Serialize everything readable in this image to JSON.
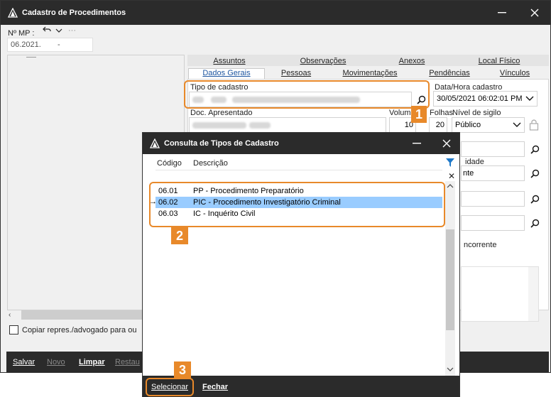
{
  "main": {
    "title": "Cadastro de Procedimentos",
    "nmp_label": "Nº MP :",
    "nmp_value": "06.2021.",
    "nmp_dash": "-",
    "tabs_row1": [
      "Assuntos",
      "Observações",
      "Anexos",
      "Local Físico"
    ],
    "tabs_row2": [
      "Dados Gerais",
      "Pessoas",
      "Movimentações",
      "Pendências",
      "Vínculos"
    ],
    "tipo_label": "Tipo de cadastro",
    "datahora_label": "Data/Hora cadastro",
    "datahora_value": "30/05/2021 06:02:01 PM",
    "doc_label": "Doc. Apresentado",
    "volume_label": "Volume",
    "volume_value": "10",
    "folhas_label": "Folhas",
    "folhas_value": "20",
    "sigilo_label": "Nível de sigilo",
    "sigilo_value": "Público",
    "unidade_label": "idade",
    "unidade_value": "nte",
    "concorrente_label": "ncorrente",
    "copiar_label": "Copiar repres./advogado para ou",
    "bottom": {
      "salvar": "Salvar",
      "novo": "Novo",
      "limpar": "Limpar",
      "restaurar": "Restau"
    }
  },
  "dialog": {
    "title": "Consulta de Tipos de Cadastro",
    "col_codigo": "Código",
    "col_descricao": "Descrição",
    "rows": [
      {
        "codigo": "06.01",
        "descricao": "PP - Procedimento Preparatório"
      },
      {
        "codigo": "06.02",
        "descricao": "PIC - Procedimento Investigatório Criminal"
      },
      {
        "codigo": "06.03",
        "descricao": "IC - Inquérito Civil"
      }
    ],
    "selecionar": "Selecionar",
    "fechar": "Fechar"
  },
  "badges": [
    "1",
    "2",
    "3"
  ],
  "icons": [
    "app-logo-icon",
    "minimize-icon",
    "close-icon",
    "undo-icon",
    "chevron-down-icon",
    "more-icon",
    "search-icon",
    "lock-icon",
    "filter-icon",
    "row-arrow-icon",
    "checkbox-icon"
  ],
  "colors": {
    "accent": "#e8892a",
    "titlebar": "#2b2b2b",
    "selection": "#99ccff",
    "active_tab_text": "#1e56a0"
  }
}
